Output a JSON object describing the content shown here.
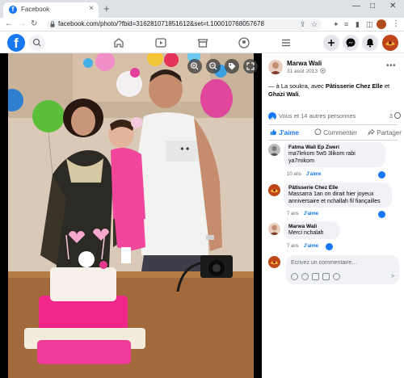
{
  "browser": {
    "tab_title": "Facebook",
    "tab_favicon": "f",
    "url": "facebook.com/photo/?fbid=316281071851612&set=t.100010768057678"
  },
  "fb": {
    "logo_letter": "f"
  },
  "post": {
    "author": "Marwa Wali",
    "date": "31 août 2013",
    "caption_prefix": "— à La soukra, avec ",
    "caption_tagged1": "Pâtisserie Chez Elle",
    "caption_mid": " et ",
    "caption_tagged2": "Ghazi Wali",
    "caption_suffix": ".",
    "reactions_text": "Vous et 14 autres personnes",
    "comment_count": "3",
    "actions": {
      "like": "J'aime",
      "comment": "Commenter",
      "share": "Partager"
    }
  },
  "comments": [
    {
      "author": "Fatma Wali Ep Zweri",
      "text": "ma7lekom 5w5 3likom rabi ya7mikom",
      "age": "10 ans",
      "like_label": "J'aime"
    },
    {
      "author": "Pâtisserie Chez Elle",
      "text": "Massarra 1an on dirait hier joyeux anniversaire et nchallah fil fiançailles",
      "age": "7 ans",
      "like_label": "J'aime"
    },
    {
      "author": "Marwa Wali",
      "text": "Merci nchalah",
      "age": "7 ans",
      "like_label": "J'aime"
    }
  ],
  "composer": {
    "placeholder": "Écrivez un commentaire…"
  },
  "colors": {
    "fb_blue": "#1877f2",
    "bubble": "#f0f2f5",
    "muted_text": "#65676b"
  }
}
